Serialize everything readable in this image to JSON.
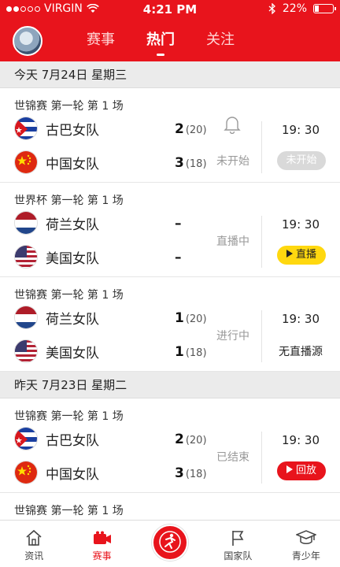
{
  "status_bar": {
    "carrier": "VIRGIN",
    "time": "4:21 PM",
    "battery": "22%"
  },
  "header": {
    "tabs": [
      {
        "label": "赛事",
        "active": false
      },
      {
        "label": "热门",
        "active": true
      },
      {
        "label": "关注",
        "active": false
      }
    ]
  },
  "sections": [
    {
      "title": "今天  7月24日  星期三",
      "matches": [
        {
          "league": "世锦赛 第一轮 第 1 场",
          "team1": {
            "name": "古巴女队",
            "score": "2",
            "sub": "(20)"
          },
          "team2": {
            "name": "中国女队",
            "score": "3",
            "sub": "(18)"
          },
          "status": "未开始",
          "time": "19:  30",
          "action": "未开始"
        },
        {
          "league": "世界杯 第一轮 第 1 场",
          "team1": {
            "name": "荷兰女队",
            "score": "–",
            "sub": ""
          },
          "team2": {
            "name": "美国女队",
            "score": "–",
            "sub": ""
          },
          "status": "直播中",
          "time": "19:  30",
          "action": "直播"
        },
        {
          "league": "世锦赛 第一轮 第 1 场",
          "team1": {
            "name": "荷兰女队",
            "score": "1",
            "sub": "(20)"
          },
          "team2": {
            "name": "美国女队",
            "score": "1",
            "sub": "(18)"
          },
          "status": "进行中",
          "time": "19:  30",
          "action": "无直播源"
        }
      ]
    },
    {
      "title": "昨天  7月23日  星期二",
      "matches": [
        {
          "league": "世锦赛 第一轮 第 1 场",
          "team1": {
            "name": "古巴女队",
            "score": "2",
            "sub": "(20)"
          },
          "team2": {
            "name": "中国女队",
            "score": "3",
            "sub": "(18)"
          },
          "status": "已结束",
          "time": "19:  30",
          "action": "回放"
        },
        {
          "league": "世锦赛 第一轮 第 1 场"
        }
      ]
    }
  ],
  "bottom_nav": [
    {
      "label": "资讯",
      "icon": "home-icon"
    },
    {
      "label": "赛事",
      "icon": "video-camera-icon",
      "active": true
    },
    {
      "label": "",
      "icon": "player-icon"
    },
    {
      "label": "国家队",
      "icon": "flag-icon"
    },
    {
      "label": "青少年",
      "icon": "graduation-cap-icon"
    }
  ],
  "colors": {
    "brand_red": "#e8141c",
    "live_yellow": "#ffd80f"
  }
}
